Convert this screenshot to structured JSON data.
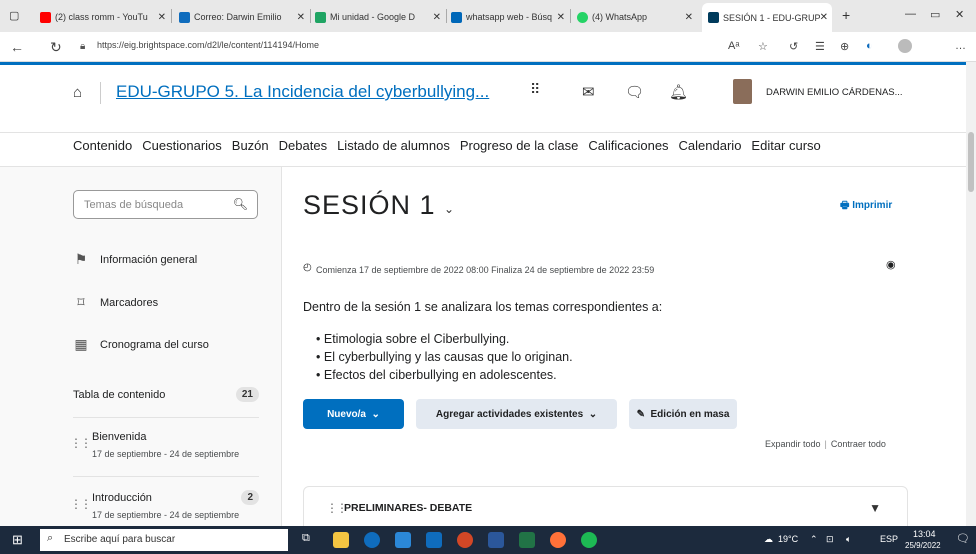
{
  "browser": {
    "tabs": [
      {
        "label": "(2) class romm - YouTu",
        "color": "#ff0000"
      },
      {
        "label": "Correo: Darwin Emilio",
        "color": "#0f6cbd"
      },
      {
        "label": "Mi unidad - Google D",
        "color": "#1fa463"
      },
      {
        "label": "whatsapp web - Búsq",
        "color": "#0067b8"
      },
      {
        "label": "(4) WhatsApp",
        "color": "#25d366"
      },
      {
        "label": "SESIÓN 1 - EDU-GRUP",
        "color": "#003b5c"
      }
    ],
    "url": "https://eig.brightspace.com/d2l/le/content/114194/Home"
  },
  "header": {
    "course_title": "EDU-GRUPO 5. La Incidencia del cyberbullying...",
    "user_name": "DARWIN EMILIO CÁRDENAS..."
  },
  "navbar": [
    "Contenido",
    "Cuestionarios",
    "Buzón",
    "Debates",
    "Listado de alumnos",
    "Progreso de la clase",
    "Calificaciones",
    "Calendario",
    "Editar curso"
  ],
  "sidebar": {
    "search_placeholder": "Temas de búsqueda",
    "items": [
      {
        "label": "Información general",
        "icon": "overview-icon"
      },
      {
        "label": "Marcadores",
        "icon": "bookmark-icon"
      },
      {
        "label": "Cronograma del curso",
        "icon": "calendar-icon"
      }
    ],
    "toc_label": "Tabla de contenido",
    "toc_count": "21",
    "modules": [
      {
        "title": "Bienvenida",
        "dates": "17 de septiembre - 24 de septiembre",
        "count": ""
      },
      {
        "title": "Introducción",
        "dates": "17 de septiembre - 24 de septiembre",
        "count": "2"
      }
    ]
  },
  "main": {
    "title": "SESIÓN 1",
    "print_label": "Imprimir",
    "dates": "Comienza 17 de septiembre de 2022 08:00  Finaliza 24 de septiembre de 2022 23:59",
    "description": "Dentro  de la  sesión 1 se analizara los temas correspondientes a:",
    "bullets": [
      "Etimologia  sobre el Ciberbullying.",
      "El cyberbullying y las causas que lo originan.",
      "Efectos del ciberbullying en adolescentes."
    ],
    "btn_new": "Nuevo/a",
    "btn_add": "Agregar actividades existentes",
    "btn_mass": "Edición en masa",
    "expand_all": "Expandir todo",
    "collapse_all": "Contraer todo",
    "module_title": "PRELIMINARES- DEBATE"
  },
  "taskbar": {
    "search_placeholder": "Escribe aquí para buscar",
    "weather": "19°C",
    "lang": "ESP",
    "time": "13:04",
    "date": "25/9/2022"
  }
}
